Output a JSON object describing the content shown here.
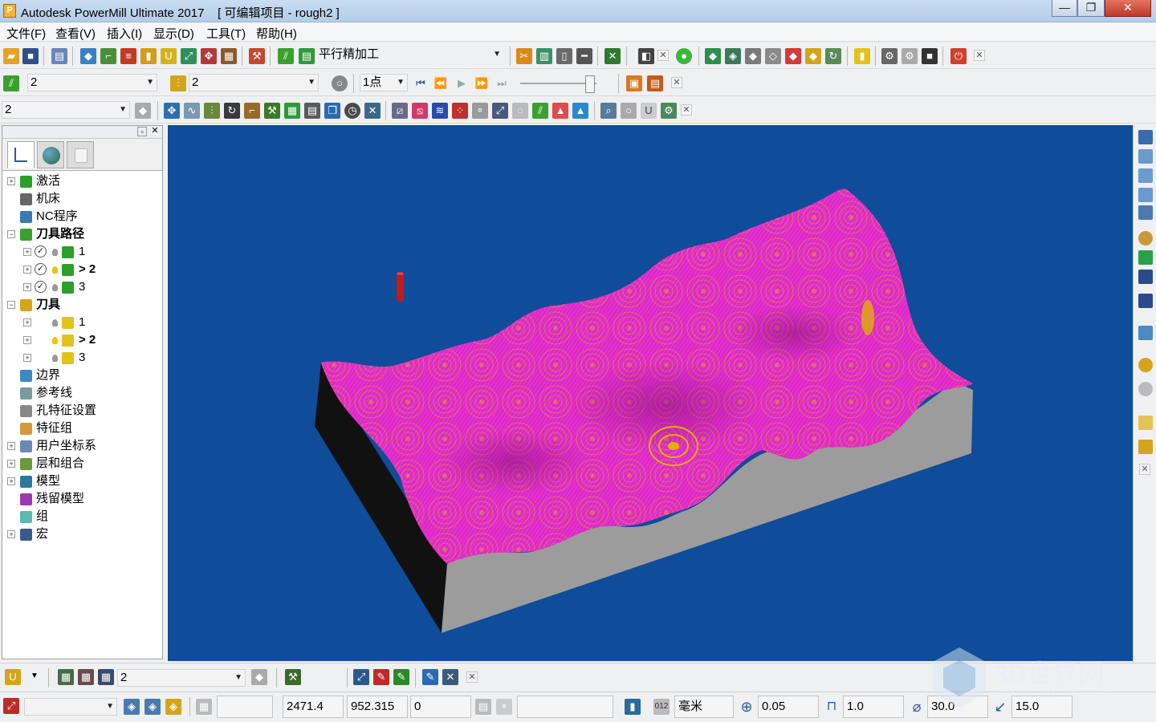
{
  "window": {
    "title": "Autodesk PowerMill Ultimate 2017    [ 可编辑项目 - rough2 ]",
    "app_icon_letter": "P",
    "minimize": "—",
    "maximize": "❐",
    "close": "✕"
  },
  "menu": [
    "文件(F)",
    "查看(V)",
    "插入(I)",
    "显示(D)",
    "工具(T)",
    "帮助(H)"
  ],
  "toolbar1": {
    "strategy_label": "平行精加工"
  },
  "toolbar2": {
    "toolpath_select": "2",
    "tool_select": "2",
    "points_label": "1点"
  },
  "toolbar3": {
    "select_value": "2"
  },
  "tree": [
    {
      "label": "激活",
      "bold": false
    },
    {
      "label": "机床",
      "bold": false
    },
    {
      "label": "NC程序",
      "bold": false
    },
    {
      "label": "刀具路径",
      "bold": true
    },
    {
      "label": "1",
      "bold": false
    },
    {
      "label": "> 2",
      "bold": true
    },
    {
      "label": "3",
      "bold": false
    },
    {
      "label": "刀具",
      "bold": true
    },
    {
      "label": "1",
      "bold": false
    },
    {
      "label": "> 2",
      "bold": true
    },
    {
      "label": "3",
      "bold": false
    },
    {
      "label": "边界",
      "bold": false
    },
    {
      "label": "参考线",
      "bold": false
    },
    {
      "label": "孔特征设置",
      "bold": false
    },
    {
      "label": "特征组",
      "bold": false
    },
    {
      "label": "用户坐标系",
      "bold": false
    },
    {
      "label": "层和组合",
      "bold": false
    },
    {
      "label": "模型",
      "bold": false
    },
    {
      "label": "残留模型",
      "bold": false
    },
    {
      "label": "组",
      "bold": false
    },
    {
      "label": "宏",
      "bold": false
    }
  ],
  "bottom_toolbar": {
    "tool_select": "2"
  },
  "status": {
    "x": "2471.4",
    "y": "952.315",
    "z": "0",
    "units": "毫米",
    "tolerance": "0.05",
    "thickness": "1.0",
    "diameter": "30.0",
    "stepover": "15.0"
  },
  "watermark": {
    "text": "3D世界网",
    "url": "WWW.3DSJW.COM"
  },
  "colors": {
    "viewport_bg": "#0f4c9a",
    "surface": "#e025d8",
    "toolpath": "#e0b000",
    "block_side": "#9c9c9c",
    "block_dark": "#111111"
  }
}
